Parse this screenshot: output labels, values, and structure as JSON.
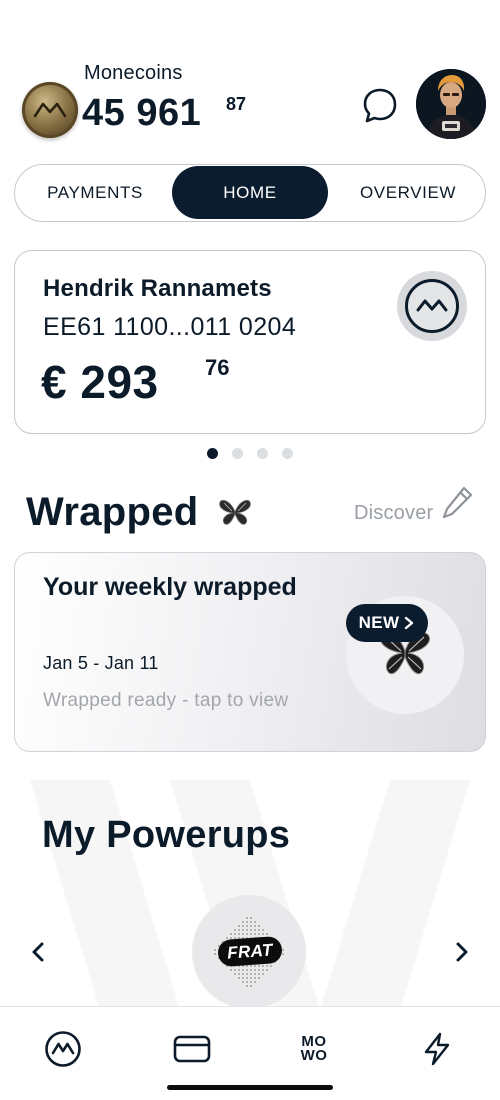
{
  "header": {
    "coins_label": "Monecoins",
    "coins_whole": "45 961",
    "coins_decimal": "87",
    "coin_icon": "monecoin-icon",
    "chat_icon": "chat-bubble-icon",
    "avatar_icon": "user-avatar"
  },
  "tabs": [
    {
      "label": "PAYMENTS",
      "active": false
    },
    {
      "label": "HOME",
      "active": true
    },
    {
      "label": "OVERVIEW",
      "active": false
    }
  ],
  "account": {
    "name": "Hendrik Rannamets",
    "iban": "EE61 1100...011 0204",
    "balance_whole": "€ 293",
    "balance_decimal": "76",
    "logo_icon": "bank-logo-icon"
  },
  "pager": {
    "count": 4,
    "active_index": 0
  },
  "wrapped": {
    "title": "Wrapped",
    "discover_label": "Discover",
    "card_title": "Your weekly wrapped",
    "date_range": "Jan 5 - Jan 11",
    "subtitle": "Wrapped ready - tap to view",
    "badge_label": "NEW"
  },
  "powerups": {
    "title": "My Powerups",
    "item_label": "FRAT"
  },
  "bottom_nav": {
    "mowo_top": "MO",
    "mowo_bottom": "WO",
    "items": [
      "home-logo-icon",
      "card-icon",
      "mowo-logo",
      "lightning-icon"
    ]
  },
  "colors": {
    "primary": "#0b1c2e",
    "muted_text": "#a2a6ab",
    "border": "#c4c9cf"
  }
}
